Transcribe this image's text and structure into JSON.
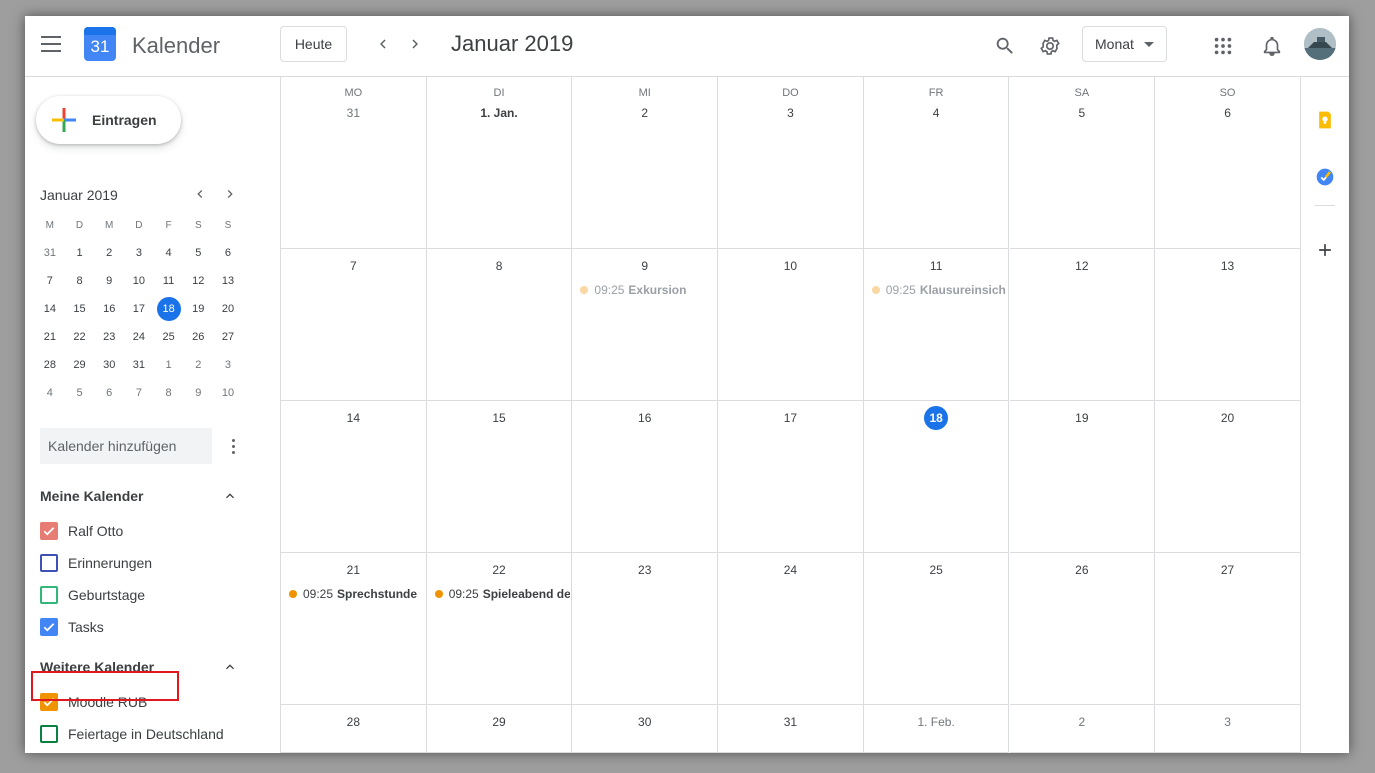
{
  "header": {
    "logo_number": "31",
    "app_title": "Kalender",
    "today_label": "Heute",
    "current_month": "Januar 2019",
    "view_label": "Monat"
  },
  "sidebar": {
    "create_label": "Eintragen",
    "mini_calendar": {
      "title": "Januar 2019",
      "weekday_heads": [
        "M",
        "D",
        "M",
        "D",
        "F",
        "S",
        "S"
      ],
      "weeks": [
        [
          "31",
          "1",
          "2",
          "3",
          "4",
          "5",
          "6"
        ],
        [
          "7",
          "8",
          "9",
          "10",
          "11",
          "12",
          "13"
        ],
        [
          "14",
          "15",
          "16",
          "17",
          "18",
          "19",
          "20"
        ],
        [
          "21",
          "22",
          "23",
          "24",
          "25",
          "26",
          "27"
        ],
        [
          "28",
          "29",
          "30",
          "31",
          "1",
          "2",
          "3"
        ],
        [
          "4",
          "5",
          "6",
          "7",
          "8",
          "9",
          "10"
        ]
      ]
    },
    "add_calendar_placeholder": "Kalender hinzufügen",
    "my_calendars_title": "Meine Kalender",
    "my_calendars": [
      {
        "name": "Ralf Otto",
        "checked": true,
        "color": "#e67c73"
      },
      {
        "name": "Erinnerungen",
        "checked": false,
        "color": "#3f51b5"
      },
      {
        "name": "Geburtstage",
        "checked": false,
        "color": "#33b679"
      },
      {
        "name": "Tasks",
        "checked": true,
        "color": "#4285f4"
      }
    ],
    "other_calendars_title": "Weitere Kalender",
    "other_calendars": [
      {
        "name": "Moodle RUB",
        "checked": true,
        "color": "#f09300"
      },
      {
        "name": "Feiertage in Deutschland",
        "checked": false,
        "color": "#0b8043"
      }
    ]
  },
  "month_grid": {
    "weekdays": [
      "MO",
      "DI",
      "MI",
      "DO",
      "FR",
      "SA",
      "SO"
    ],
    "weeks": [
      [
        "31",
        "1. Jan.",
        "2",
        "3",
        "4",
        "5",
        "6"
      ],
      [
        "7",
        "8",
        "9",
        "10",
        "11",
        "12",
        "13"
      ],
      [
        "14",
        "15",
        "16",
        "17",
        "18",
        "19",
        "20"
      ],
      [
        "21",
        "22",
        "23",
        "24",
        "25",
        "26",
        "27"
      ],
      [
        "28",
        "29",
        "30",
        "31",
        "1. Feb.",
        "2",
        "3"
      ]
    ],
    "events": [
      {
        "week": 1,
        "day": 2,
        "time": "09:25",
        "title": "Exkursion",
        "past": true
      },
      {
        "week": 1,
        "day": 4,
        "time": "09:25",
        "title": "Klausureinsich",
        "past": true
      },
      {
        "week": 3,
        "day": 0,
        "time": "09:25",
        "title": "Sprechstunde",
        "past": false
      },
      {
        "week": 3,
        "day": 1,
        "time": "09:25",
        "title": "Spieleabend de",
        "past": false
      }
    ]
  },
  "colors": {
    "accent": "#1a73e8",
    "event_future": "#f09300",
    "event_past": "#fad7a3",
    "highlight_box": "#e0191f"
  }
}
